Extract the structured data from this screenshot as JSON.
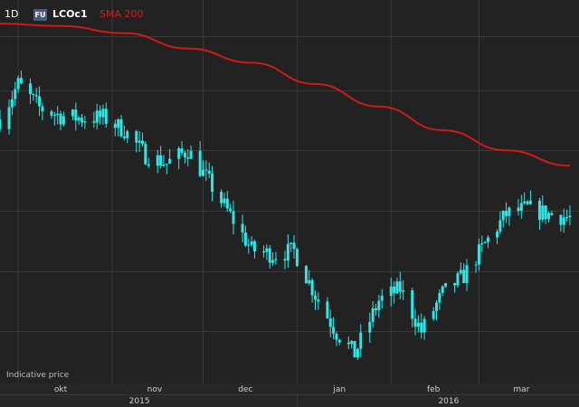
{
  "header": {
    "interval": "1D",
    "badge": "FU",
    "symbol": "LCOc1",
    "indicator": "SMA 200"
  },
  "footer_note": "Indicative price",
  "colors": {
    "background": "#222222",
    "grid": "#3a3a3a",
    "candles": "#2ee6e6",
    "sma": "#d01a1a",
    "axis_text": "#cfcfcf",
    "axis_bg": "#262626"
  },
  "chart_data": {
    "type": "line",
    "title": "LCOc1",
    "x_month_labels": [
      "okt",
      "nov",
      "dec",
      "jan",
      "feb",
      "mar"
    ],
    "x_year_labels": [
      "2015",
      "2016"
    ],
    "x_range": [
      "2015-09-25",
      "2016-03-31"
    ],
    "y_axis_visible": false,
    "grid": true,
    "series": [
      {
        "name": "LCOc1",
        "kind": "candlestick-daily",
        "x": [
          "2015-09-25",
          "2015-10-01",
          "2015-10-08",
          "2015-10-15",
          "2015-10-22",
          "2015-10-29",
          "2015-11-05",
          "2015-11-12",
          "2015-11-19",
          "2015-11-26",
          "2015-12-03",
          "2015-12-10",
          "2015-12-17",
          "2015-12-24",
          "2015-12-31",
          "2016-01-07",
          "2016-01-14",
          "2016-01-20",
          "2016-01-28",
          "2016-02-04",
          "2016-02-11",
          "2016-02-18",
          "2016-02-25",
          "2016-03-03",
          "2016-03-10",
          "2016-03-17",
          "2016-03-24",
          "2016-03-31"
        ],
        "values": [
          48.5,
          51.5,
          49.5,
          48.8,
          48.6,
          48.7,
          47.6,
          45.5,
          44.8,
          45.9,
          43.2,
          40.4,
          37.5,
          37.1,
          37.4,
          33.7,
          30.5,
          28.7,
          33.2,
          34.2,
          30.6,
          33.8,
          35.3,
          38.0,
          40.5,
          41.0,
          40.5,
          40.2
        ]
      },
      {
        "name": "SMA 200",
        "kind": "line",
        "x": [
          "2015-09-25",
          "2015-10-15",
          "2015-11-05",
          "2015-11-26",
          "2015-12-17",
          "2016-01-07",
          "2016-01-28",
          "2016-02-18",
          "2016-03-10",
          "2016-03-31"
        ],
        "values": [
          56.6,
          56.4,
          55.8,
          54.5,
          53.3,
          51.5,
          49.6,
          47.6,
          45.9,
          44.6
        ]
      }
    ]
  }
}
